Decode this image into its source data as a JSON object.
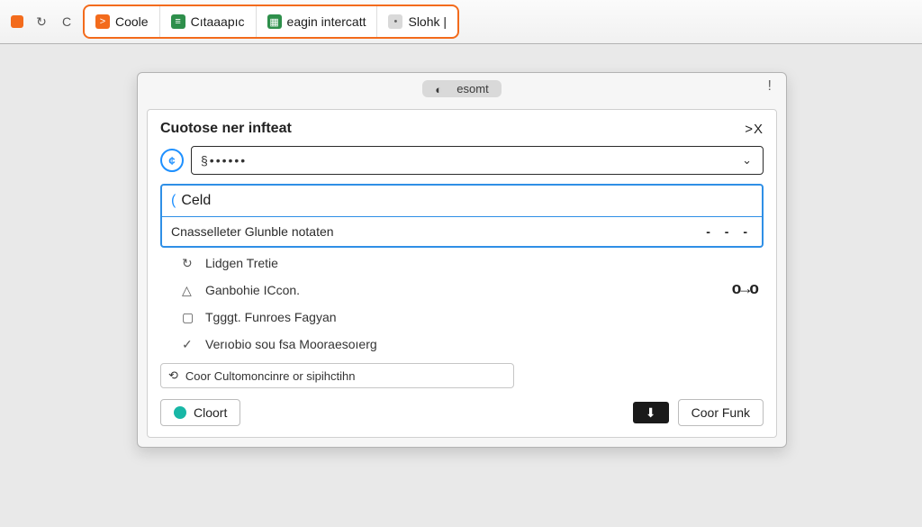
{
  "toolbar": {
    "tabs": [
      {
        "label": "Coole",
        "icon_bg": "#f36b1c",
        "icon_glyph": ">"
      },
      {
        "label": "Cıtaaapıc",
        "icon_bg": "#2e8f4b",
        "icon_glyph": "≡"
      },
      {
        "label": "eagin intercatt",
        "icon_bg": "#2e8f4b",
        "icon_glyph": "▦"
      },
      {
        "label": "Slohk |",
        "icon_bg": "#d9d9d9",
        "icon_glyph": "•"
      }
    ]
  },
  "panel": {
    "pill_label": "esomt",
    "title": "Cuotose ner infteat",
    "close_glyph": ">X",
    "alert_glyph": "!",
    "selector_value": "§••••••",
    "input_value": "Celd",
    "sub_row": {
      "label": "Cnasselleter Glunble notaten",
      "dashes": "- - -"
    },
    "options": [
      {
        "icon": "↻",
        "label": "Lidgen Tretie",
        "extra": ""
      },
      {
        "icon": "△",
        "label": "Ganbohie ICcon.",
        "extra": "o→o"
      },
      {
        "icon": "▢",
        "label": "Tgggt. Funroes Fagyan",
        "extra": ""
      },
      {
        "icon": "✓",
        "label": "Verıobio sou fsa Mooraesoıerg",
        "extra": ""
      }
    ],
    "hint": {
      "icon": "⟲",
      "label": "Coor Cultomoncinre or sipihctihn"
    },
    "footer": {
      "left_button": "Cloort",
      "right_button": "Coor Funk",
      "dark_icon_glyph": "⬇"
    }
  }
}
